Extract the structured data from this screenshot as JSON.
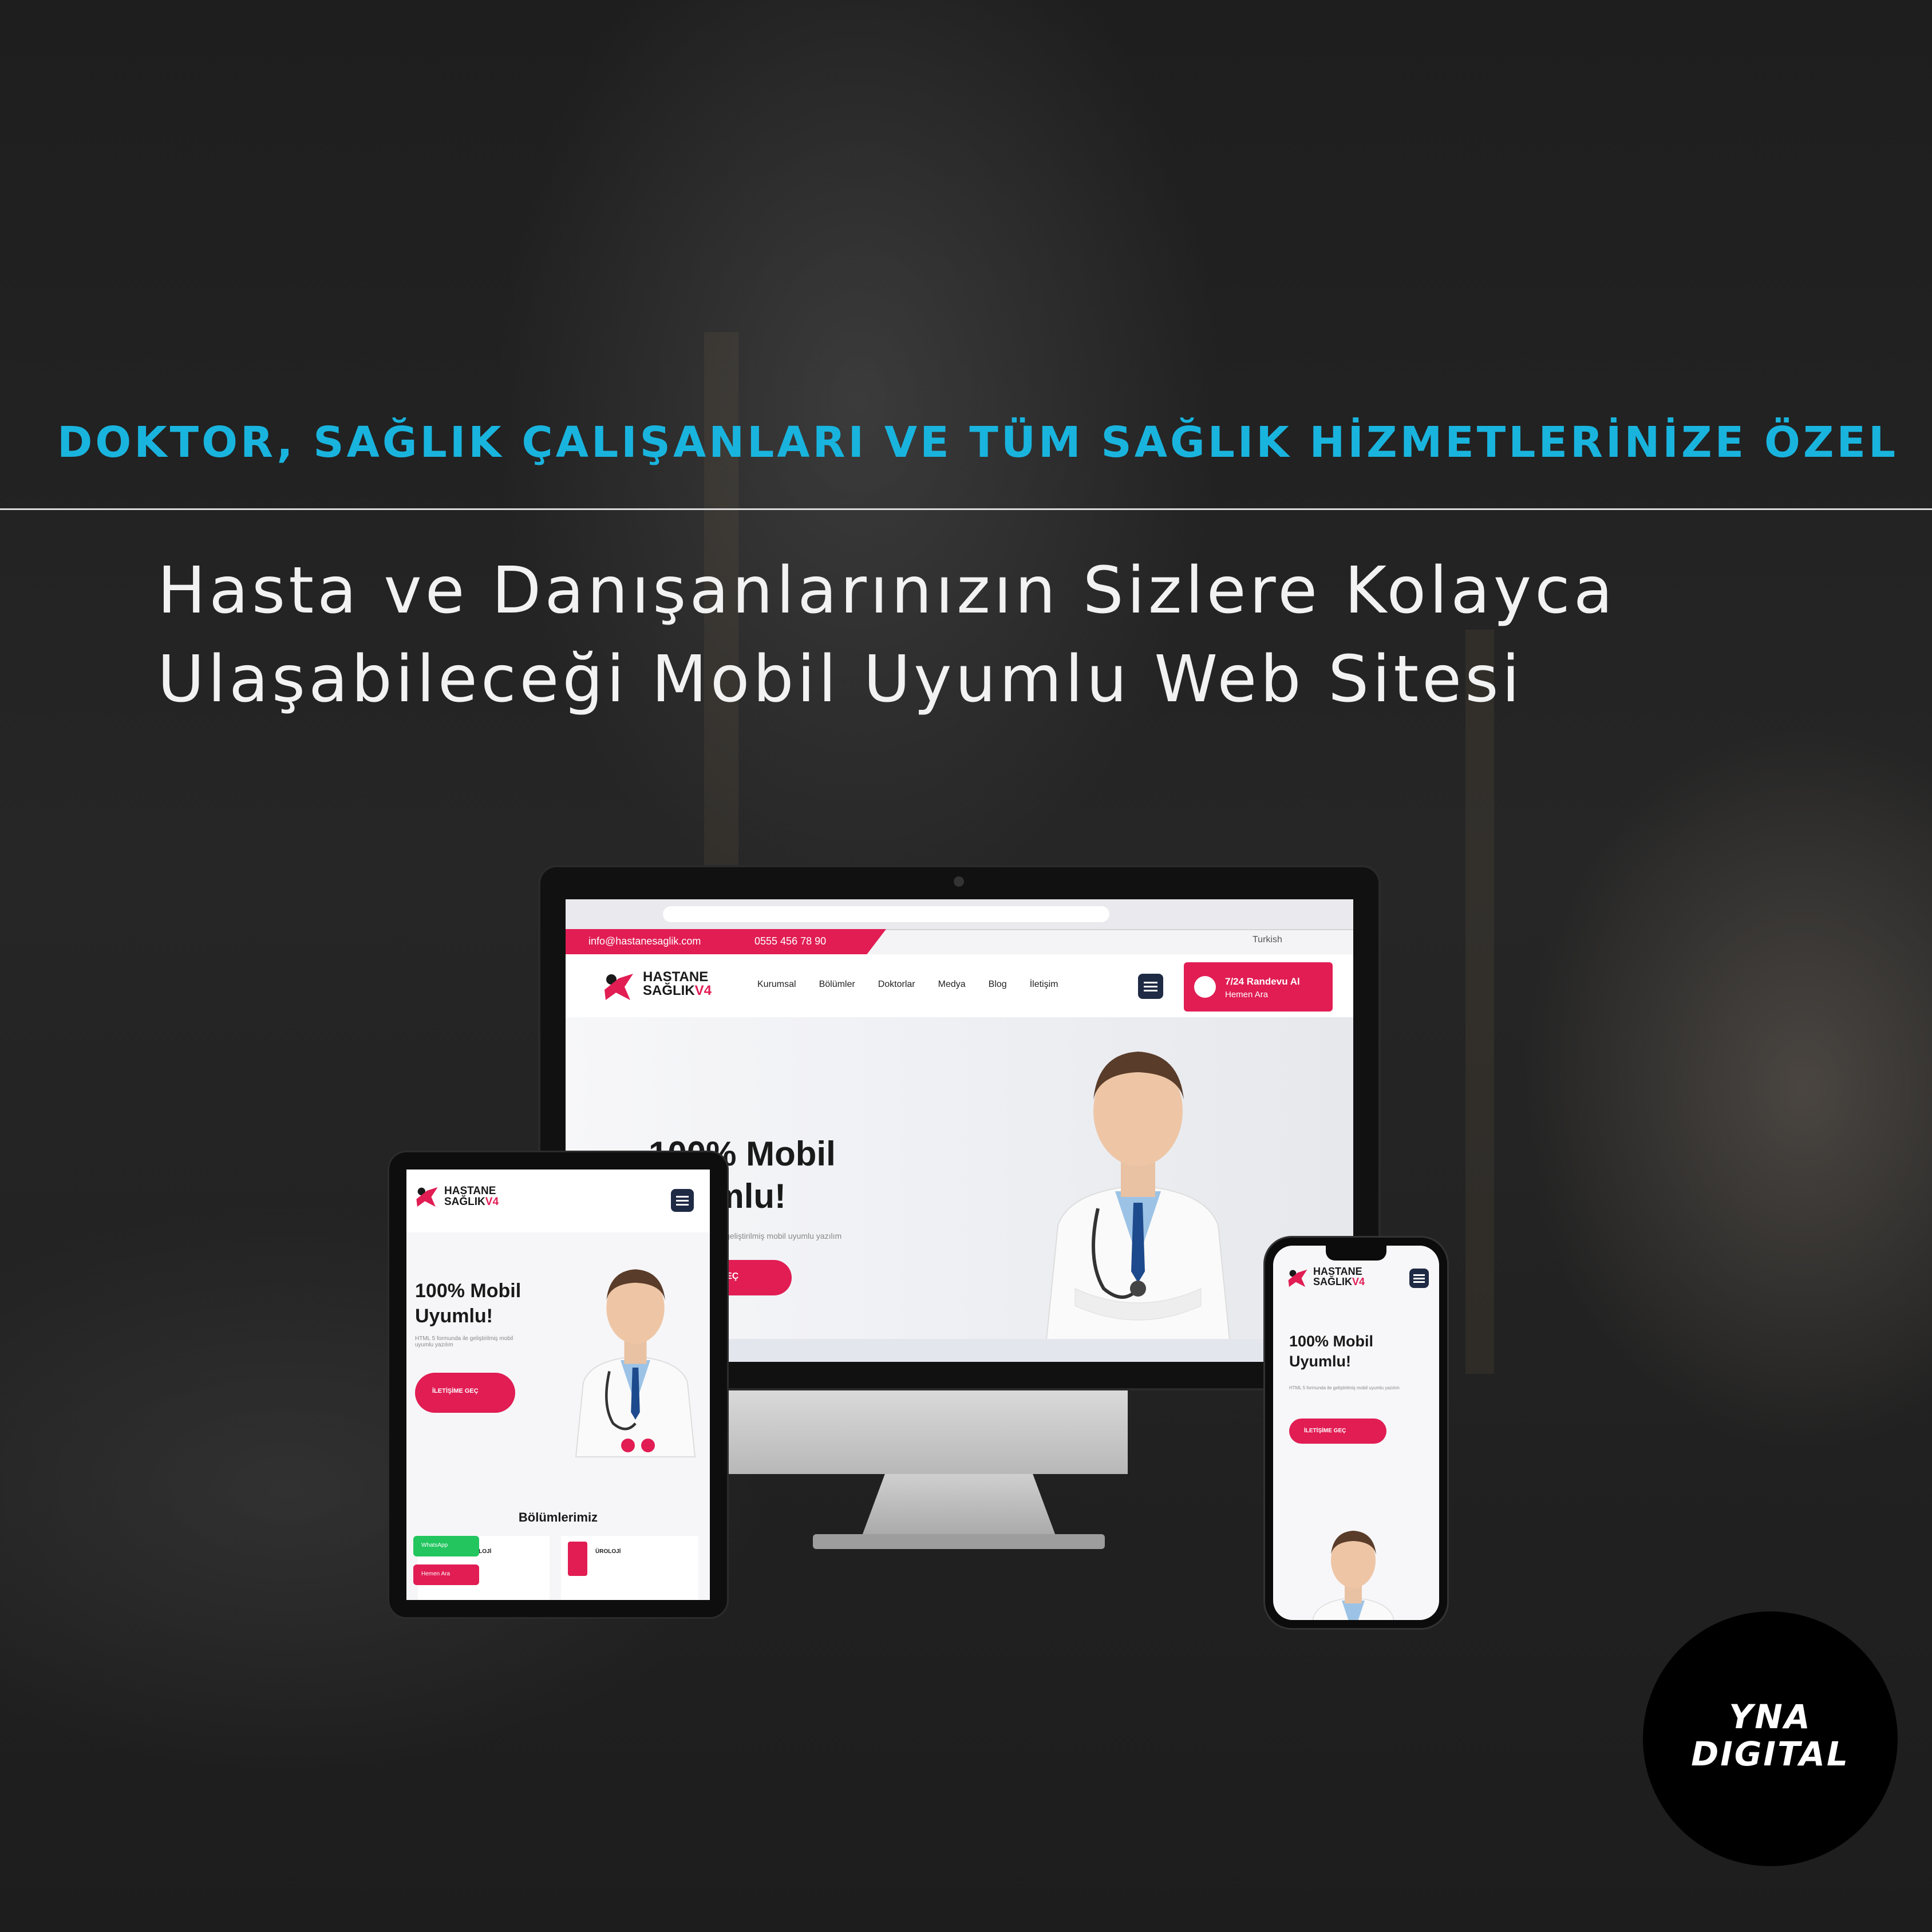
{
  "kicker": "DOKTOR, SAĞLIK ÇALIŞANLARI VE TÜM SAĞLIK HİZMETLERİNİZE ÖZEL",
  "headline": {
    "line1": "Hasta ve Danışanlarınızın Sizlere Kolayca",
    "line2": "Ulaşabileceği Mobil Uyumlu Web Sitesi"
  },
  "colors": {
    "accent": "#19b4de",
    "brand": "#e11d54",
    "text": "#f2f2f2"
  },
  "monitor_site": {
    "email": "info@hastanesaglik.com",
    "phone": "0555 456 78 90",
    "language": "Turkish",
    "logo_line1": "HASTANE",
    "logo_line2": "SAĞLIK",
    "logo_version": "V4",
    "nav": [
      "Kurumsal",
      "Bölümler",
      "Doktorlar",
      "Medya",
      "Blog",
      "İletişim"
    ],
    "appointment_line1": "7/24 Randevu Al",
    "appointment_line2": "Hemen Ara",
    "hero_title_line1": "100% Mobil",
    "hero_title_line2": "Uyumlu!",
    "hero_sub": "HTML 5 formunda ile geliştirilmiş mobil uyumlu yazılım",
    "hero_button": "İLETİŞİME GEÇ"
  },
  "tablet_site": {
    "logo_line1": "HASTANE",
    "logo_line2": "SAĞLIK",
    "logo_version": "V4",
    "hero_title_line1": "100% Mobil",
    "hero_title_line2": "Uyumlu!",
    "hero_sub": "HTML 5 formunda ile geliştirilmiş mobil uyumlu yazılım",
    "hero_button": "İLETİŞİME GEÇ",
    "section_title": "Bölümlerimiz",
    "card1": "KARDİYOLOJİ",
    "card2": "ÜROLOJİ",
    "whatsapp": "WhatsApp",
    "call": "Hemen Ara"
  },
  "phone_site": {
    "logo_line1": "HASTANE",
    "logo_line2": "SAĞLIK",
    "logo_version": "V4",
    "hero_title_line1": "100% Mobil",
    "hero_title_line2": "Uyumlu!",
    "hero_sub": "HTML 5 formunda ile geliştirilmiş mobil uyumlu yazılım",
    "hero_button": "İLETİŞİME GEÇ"
  },
  "brand_badge": {
    "line1": "YNA",
    "line2": "DIGITAL"
  }
}
